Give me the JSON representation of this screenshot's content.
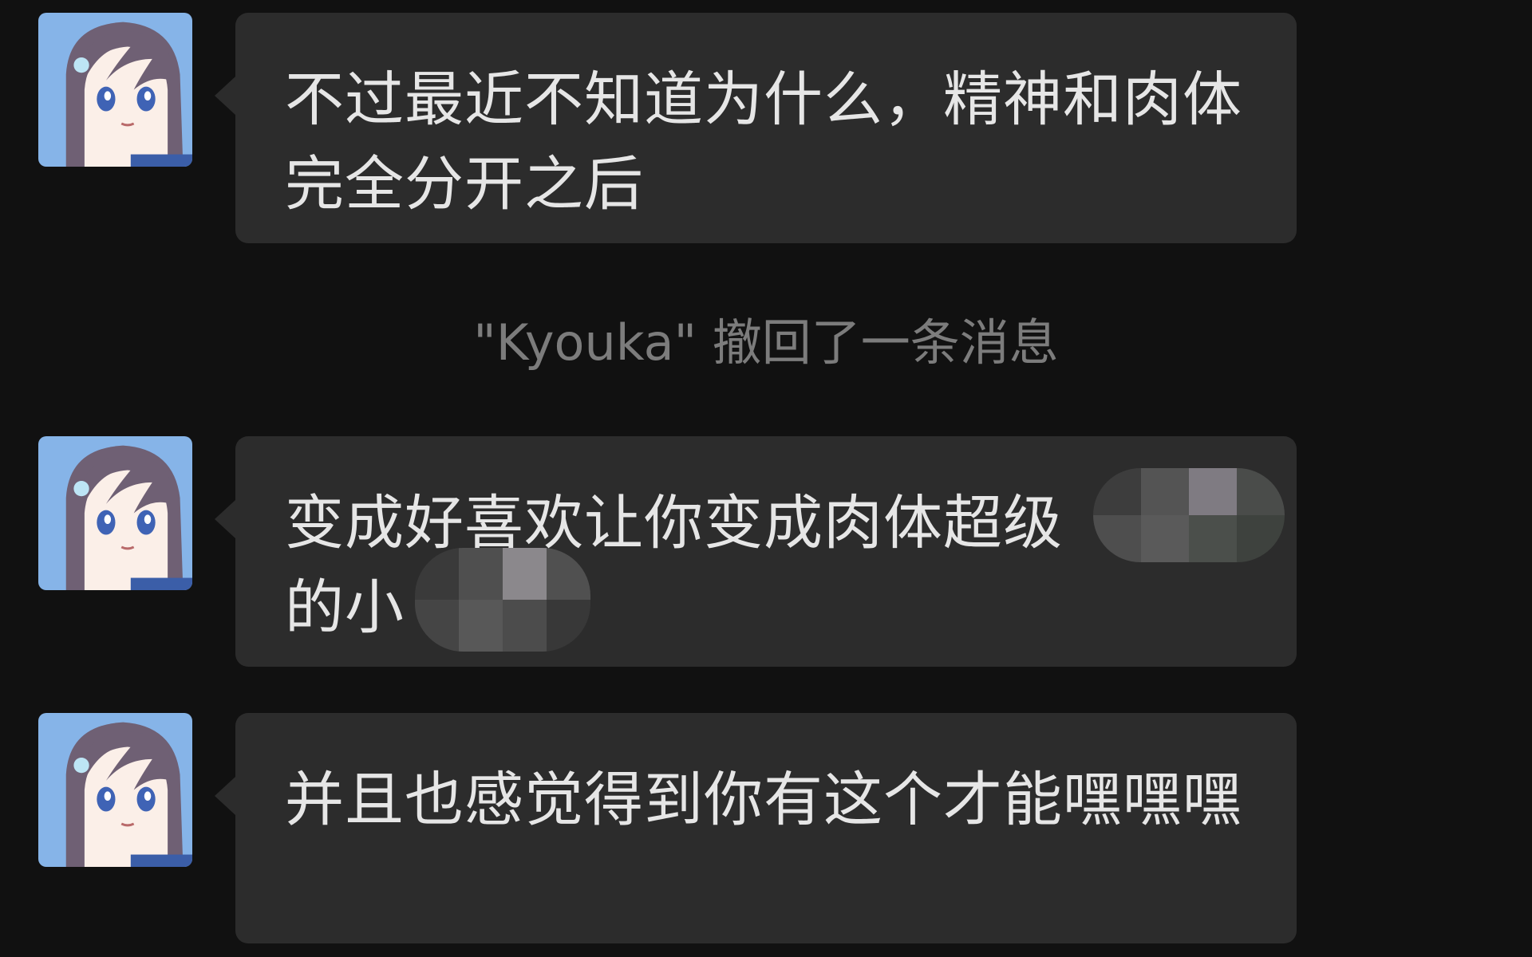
{
  "conversation": {
    "messages": [
      {
        "sender": "Kyouka",
        "text": "不过最近不知道为什么，精神和肉体完全分开之后"
      },
      {
        "sender": "Kyouka",
        "text": "变成好喜欢让你变成肉体超级",
        "text_line2": "的小",
        "redacted": true
      },
      {
        "sender": "Kyouka",
        "text": "并且也感觉得到你有这个才能嘿嘿嘿"
      }
    ],
    "system_notice": "\"Kyouka\" 撤回了一条消息"
  },
  "colors": {
    "background": "#111111",
    "bubble": "#2c2c2c",
    "text": "#e6e6e6",
    "system_text": "#7c7c7c"
  },
  "icons": {
    "avatar": "anime-girl-avatar-icon"
  }
}
